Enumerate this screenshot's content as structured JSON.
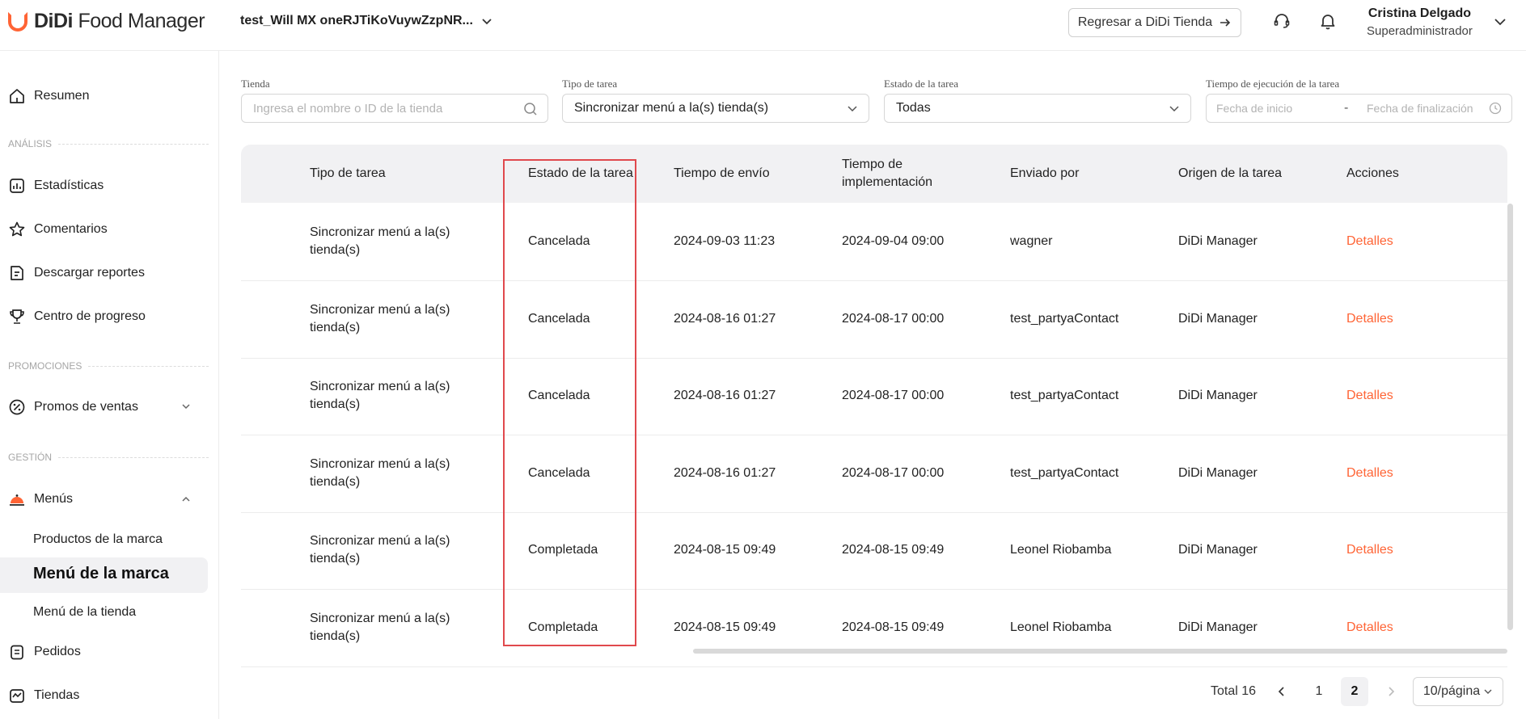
{
  "header": {
    "logo_bold": "DiDi",
    "logo_light": "Food Manager",
    "store_name": "test_Will MX oneRJTiKoVuywZzpNR...",
    "back_button": "Regresar a DiDi Tienda",
    "user_name": "Cristina Delgado",
    "user_role": "Superadministrador",
    "accent_color": "#ff6435"
  },
  "sidebar": {
    "resumen": "Resumen",
    "section_analisis": "ANÁLISIS",
    "estadisticas": "Estadísticas",
    "comentarios": "Comentarios",
    "reportes": "Descargar reportes",
    "progreso": "Centro de progreso",
    "section_promociones": "PROMOCIONES",
    "promos": "Promos de ventas",
    "section_gestion": "GESTIÓN",
    "menus": "Menús",
    "productos": "Productos de la marca",
    "menu_marca": "Menú de la marca",
    "menu_tienda": "Menú de la tienda",
    "pedidos": "Pedidos",
    "tiendas": "Tiendas"
  },
  "filters": {
    "tienda_label": "Tienda",
    "tienda_placeholder": "Ingresa el nombre o ID de la tienda",
    "tipo_label": "Tipo de tarea",
    "tipo_value": "Sincronizar menú a la(s) tienda(s)",
    "estado_label": "Estado de la tarea",
    "estado_value": "Todas",
    "tiempo_label": "Tiempo de ejecución de la tarea",
    "fecha_inicio": "Fecha de inicio",
    "separator": "-",
    "fecha_fin": "Fecha de finalización"
  },
  "table": {
    "headers": {
      "tipo": "Tipo de tarea",
      "estado": "Estado de la tarea",
      "envio": "Tiempo de envío",
      "impl_1": "Tiempo de",
      "impl_2": "implementación",
      "enviado": "Enviado por",
      "origen": "Origen de la tarea",
      "acciones": "Acciones"
    },
    "rows": [
      {
        "tipo_1": "Sincronizar menú a la(s)",
        "tipo_2": "tienda(s)",
        "estado": "Cancelada",
        "envio": "2024-09-03 11:23",
        "impl": "2024-09-04 09:00",
        "enviado": "wagner",
        "origen": "DiDi Manager",
        "accion": "Detalles"
      },
      {
        "tipo_1": "Sincronizar menú a la(s)",
        "tipo_2": "tienda(s)",
        "estado": "Cancelada",
        "envio": "2024-08-16 01:27",
        "impl": "2024-08-17 00:00",
        "enviado": "test_partyaContact",
        "origen": "DiDi Manager",
        "accion": "Detalles"
      },
      {
        "tipo_1": "Sincronizar menú a la(s)",
        "tipo_2": "tienda(s)",
        "estado": "Cancelada",
        "envio": "2024-08-16 01:27",
        "impl": "2024-08-17 00:00",
        "enviado": "test_partyaContact",
        "origen": "DiDi Manager",
        "accion": "Detalles"
      },
      {
        "tipo_1": "Sincronizar menú a la(s)",
        "tipo_2": "tienda(s)",
        "estado": "Cancelada",
        "envio": "2024-08-16 01:27",
        "impl": "2024-08-17 00:00",
        "enviado": "test_partyaContact",
        "origen": "DiDi Manager",
        "accion": "Detalles"
      },
      {
        "tipo_1": "Sincronizar menú a la(s)",
        "tipo_2": "tienda(s)",
        "estado": "Completada",
        "envio": "2024-08-15 09:49",
        "impl": "2024-08-15 09:49",
        "enviado": "Leonel Riobamba",
        "origen": "DiDi Manager",
        "accion": "Detalles"
      },
      {
        "tipo_1": "Sincronizar menú a la(s)",
        "tipo_2": "tienda(s)",
        "estado": "Completada",
        "envio": "2024-08-15 09:49",
        "impl": "2024-08-15 09:49",
        "enviado": "Leonel Riobamba",
        "origen": "DiDi Manager",
        "accion": "Detalles"
      }
    ]
  },
  "pagination": {
    "total": "Total 16",
    "page_1": "1",
    "page_2": "2",
    "page_size": "10/página"
  }
}
